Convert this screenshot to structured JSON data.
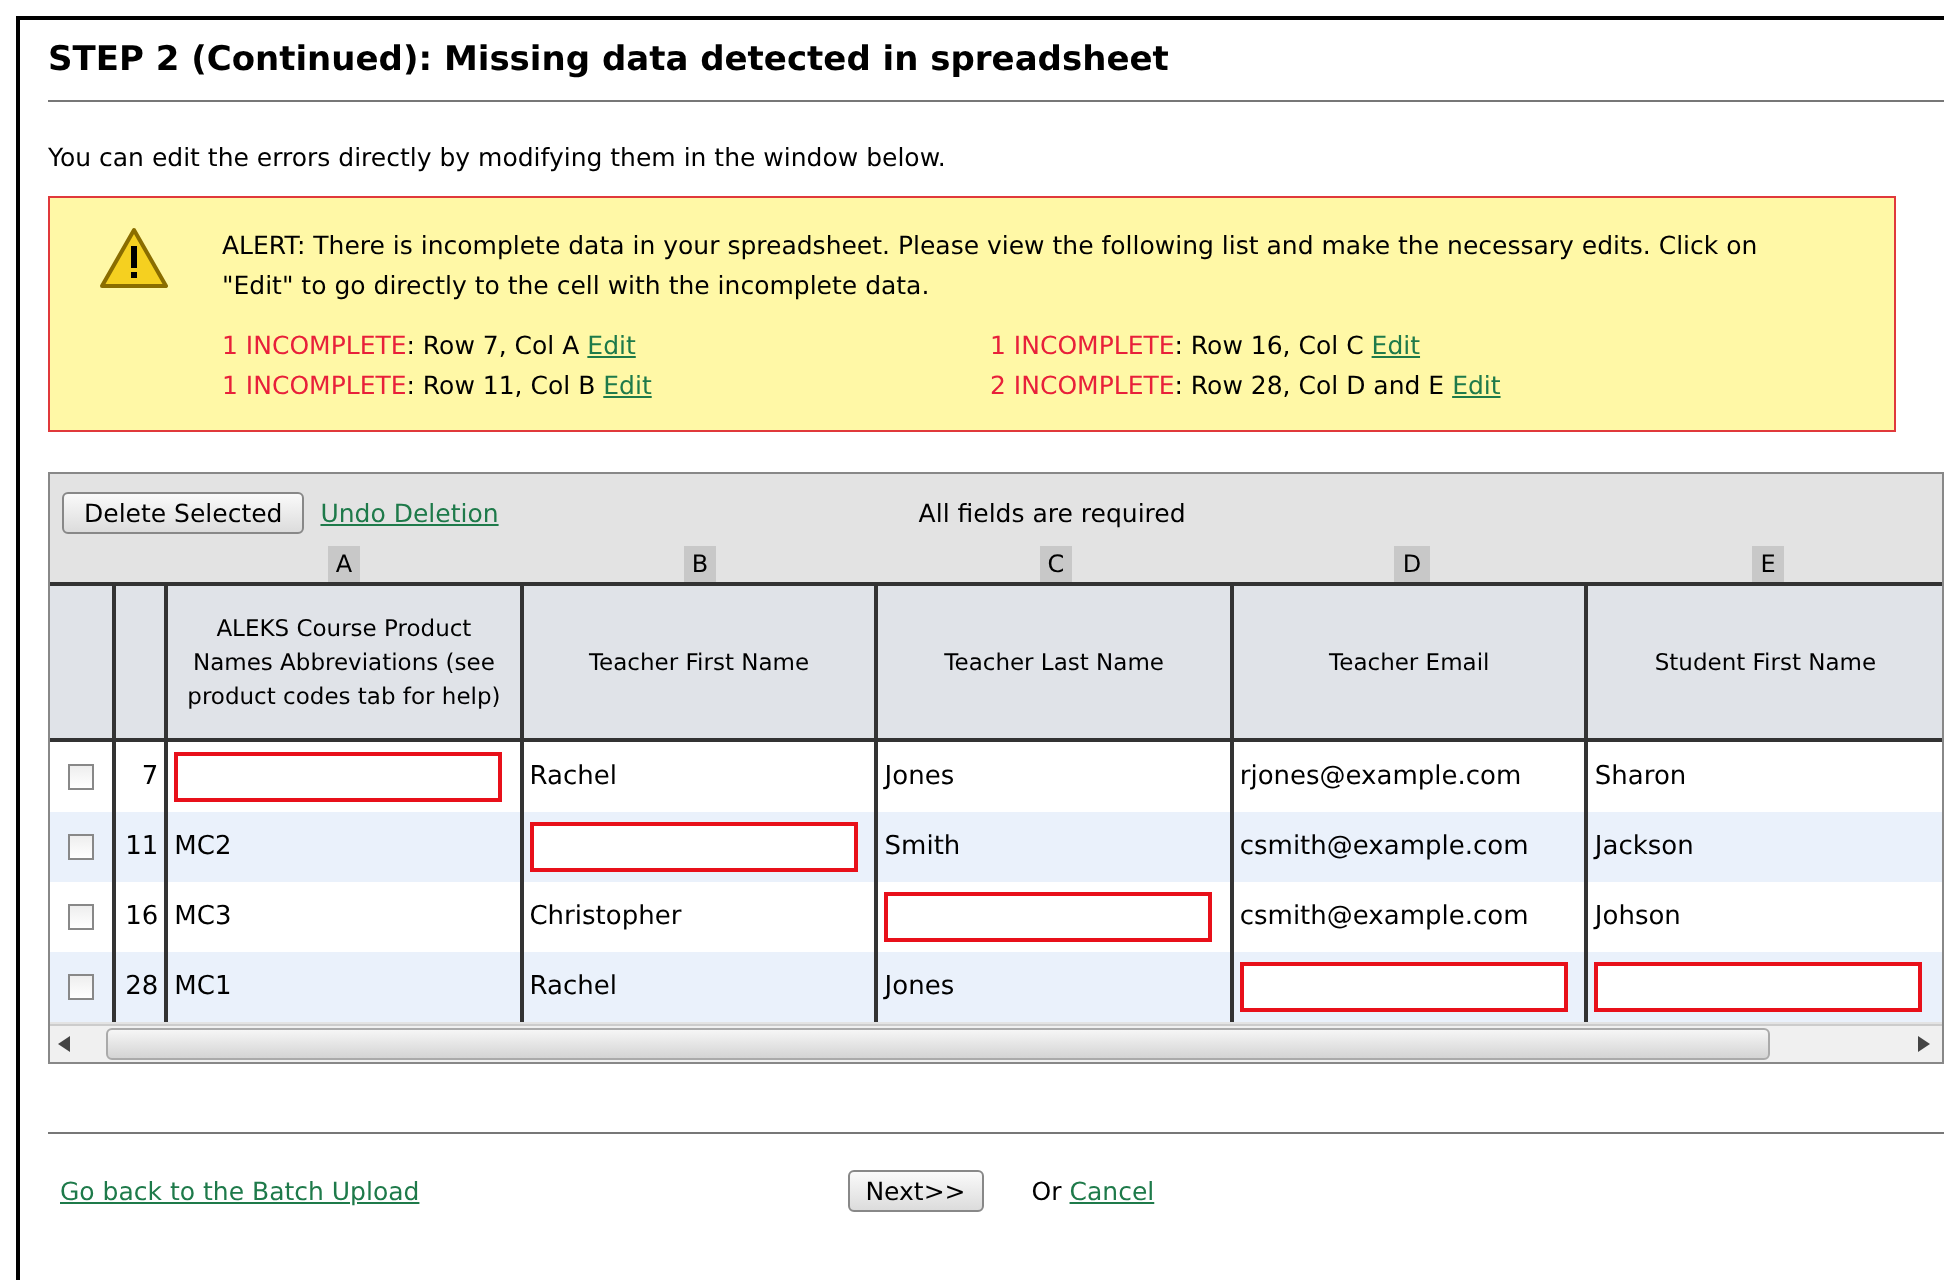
{
  "title": "STEP 2 (Continued): Missing data detected in spreadsheet",
  "intro": "You can edit the errors directly by modifying them in the window below.",
  "alert": {
    "message": "ALERT: There is incomplete data in your spreadsheet. Please view the following list and make the necessary edits. Click on \"Edit\" to go directly to the cell with the incomplete data.",
    "items": [
      {
        "count": "1 INCOMPLETE",
        "location": ": Row 7, Col A",
        "link": "Edit"
      },
      {
        "count": "1 INCOMPLETE",
        "location": ": Row 16, Col C",
        "link": "Edit"
      },
      {
        "count": "1 INCOMPLETE",
        "location": ": Row 11, Col B",
        "link": "Edit"
      },
      {
        "count": "2 INCOMPLETE",
        "location": ": Row 28, Col D and E",
        "link": "Edit"
      }
    ]
  },
  "toolbar": {
    "delete_button": "Delete Selected",
    "undo_link": "Undo Deletion",
    "note": "All fields are required"
  },
  "table": {
    "columns": [
      {
        "letter": "A",
        "heading": "ALEKS Course Product Names Abbreviations (see product codes tab for help)"
      },
      {
        "letter": "B",
        "heading": "Teacher First Name"
      },
      {
        "letter": "C",
        "heading": "Teacher Last Name"
      },
      {
        "letter": "D",
        "heading": "Teacher Email"
      },
      {
        "letter": "E",
        "heading": "Student First Name"
      }
    ],
    "rows": [
      {
        "checked": false,
        "number": "7",
        "cells": [
          {
            "kind": "missing"
          },
          {
            "kind": "text",
            "value": "Rachel"
          },
          {
            "kind": "text",
            "value": "Jones"
          },
          {
            "kind": "text",
            "value": "rjones@example.com"
          },
          {
            "kind": "text",
            "value": "Sharon"
          }
        ]
      },
      {
        "checked": false,
        "number": "11",
        "cells": [
          {
            "kind": "text",
            "value": "MC2"
          },
          {
            "kind": "missing"
          },
          {
            "kind": "text",
            "value": "Smith"
          },
          {
            "kind": "text",
            "value": "csmith@example.com"
          },
          {
            "kind": "text",
            "value": "Jackson"
          }
        ]
      },
      {
        "checked": false,
        "number": "16",
        "cells": [
          {
            "kind": "text",
            "value": "MC3"
          },
          {
            "kind": "text",
            "value": "Christopher"
          },
          {
            "kind": "missing"
          },
          {
            "kind": "text",
            "value": "csmith@example.com"
          },
          {
            "kind": "text",
            "value": "Johson"
          }
        ]
      },
      {
        "checked": false,
        "number": "28",
        "cells": [
          {
            "kind": "text",
            "value": "MC1"
          },
          {
            "kind": "text",
            "value": "Rachel"
          },
          {
            "kind": "text",
            "value": "Jones"
          },
          {
            "kind": "missing"
          },
          {
            "kind": "missing"
          }
        ]
      }
    ]
  },
  "footer": {
    "back_link": "Go back to the Batch Upload",
    "next_button": "Next>>",
    "or_text": "Or",
    "cancel_link": "Cancel"
  }
}
